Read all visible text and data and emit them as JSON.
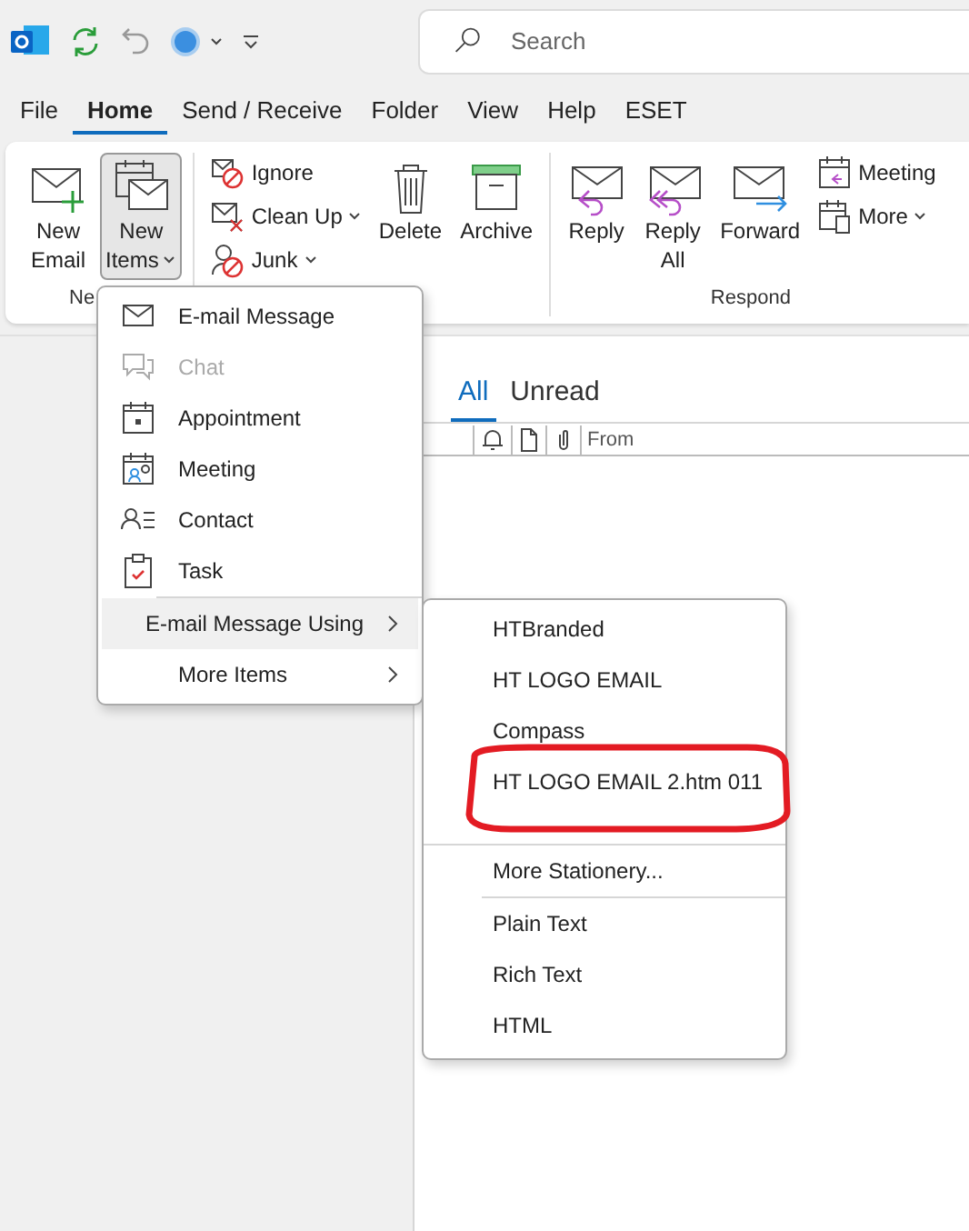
{
  "search": {
    "placeholder": "Search"
  },
  "ribbon_tabs": [
    {
      "label": "File",
      "selected": false
    },
    {
      "label": "Home",
      "selected": true
    },
    {
      "label": "Send / Receive",
      "selected": false
    },
    {
      "label": "Folder",
      "selected": false
    },
    {
      "label": "View",
      "selected": false
    },
    {
      "label": "Help",
      "selected": false
    },
    {
      "label": "ESET",
      "selected": false
    }
  ],
  "ribbon": {
    "groups": [
      {
        "label": "Ne",
        "buttons": [
          {
            "kind": "large",
            "label": "New\nEmail",
            "pressed": false,
            "dropdown": false
          },
          {
            "kind": "large",
            "label": "New\nItems",
            "pressed": true,
            "dropdown": true
          }
        ]
      },
      {
        "buttons": [
          {
            "kind": "stack",
            "items": [
              {
                "label": "Ignore",
                "dropdown": false
              },
              {
                "label": "Clean Up",
                "dropdown": true
              },
              {
                "label": "Junk",
                "dropdown": true
              }
            ]
          },
          {
            "kind": "large",
            "label": "Delete",
            "pressed": false,
            "dropdown": false
          },
          {
            "kind": "large",
            "label": "Archive",
            "pressed": false,
            "dropdown": false
          }
        ]
      },
      {
        "label": "Respond",
        "buttons": [
          {
            "kind": "large",
            "label": "Reply",
            "pressed": false,
            "dropdown": false
          },
          {
            "kind": "large",
            "label": "Reply\nAll",
            "pressed": false,
            "dropdown": false
          },
          {
            "kind": "large",
            "label": "Forward",
            "pressed": false,
            "dropdown": false
          },
          {
            "kind": "stack",
            "items": [
              {
                "label": "Meeting",
                "dropdown": false
              },
              {
                "label": "More",
                "dropdown": true
              }
            ]
          }
        ]
      }
    ]
  },
  "message_list": {
    "view_tabs": [
      {
        "label": "All",
        "selected": true
      },
      {
        "label": "Unread",
        "selected": false
      }
    ],
    "columns": [
      {
        "kind": "reminder"
      },
      {
        "kind": "type"
      },
      {
        "kind": "attachment"
      },
      {
        "kind": "text",
        "label": "From"
      }
    ]
  },
  "new_items_menu": {
    "items": [
      {
        "kind": "item",
        "label": "E-mail Message",
        "disabled": false,
        "selected": false
      },
      {
        "kind": "item",
        "label": "Chat",
        "disabled": true,
        "selected": false
      },
      {
        "kind": "item",
        "label": "Appointment",
        "disabled": false,
        "selected": false
      },
      {
        "kind": "item",
        "label": "Meeting",
        "disabled": false,
        "selected": false
      },
      {
        "kind": "item",
        "label": "Contact",
        "disabled": false,
        "selected": false
      },
      {
        "kind": "item",
        "label": "Task",
        "disabled": false,
        "selected": false
      },
      {
        "kind": "separator",
        "indented": true
      },
      {
        "kind": "submenu",
        "label": "E-mail Message Using",
        "disabled": false,
        "selected": true
      },
      {
        "kind": "submenu",
        "label": "More Items",
        "disabled": false,
        "selected": false
      }
    ]
  },
  "stationery_menu": {
    "items": [
      {
        "kind": "item",
        "label": "HTBranded"
      },
      {
        "kind": "item",
        "label": "HT LOGO EMAIL"
      },
      {
        "kind": "item",
        "label": "Compass"
      },
      {
        "kind": "item",
        "label": "HT LOGO EMAIL 2.htm 011"
      },
      {
        "kind": "separator",
        "indented": false
      },
      {
        "kind": "item",
        "label": "More Stationery..."
      },
      {
        "kind": "separator",
        "indented": true
      },
      {
        "kind": "item",
        "label": "Plain Text"
      },
      {
        "kind": "item",
        "label": "Rich Text"
      },
      {
        "kind": "item",
        "label": "HTML"
      }
    ]
  }
}
